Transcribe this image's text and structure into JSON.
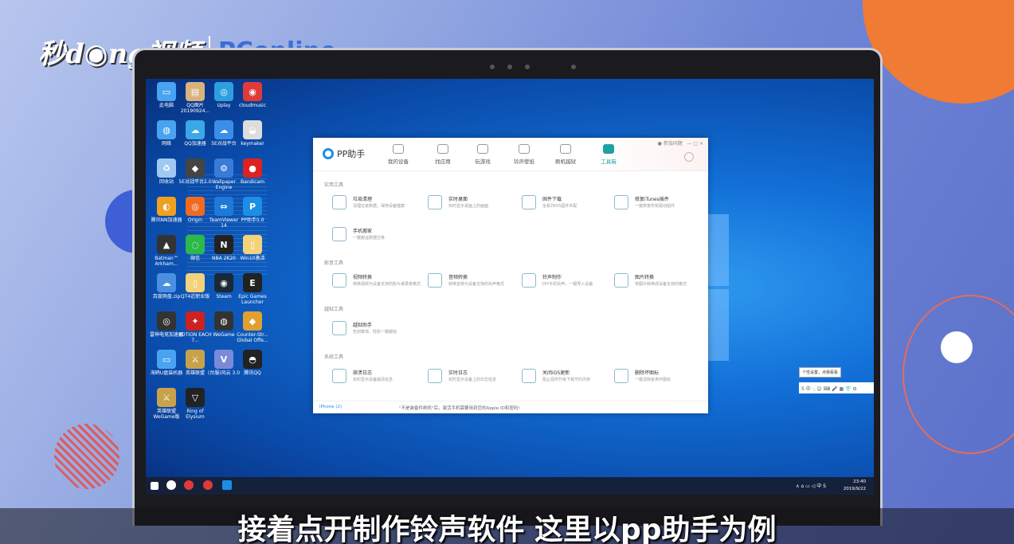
{
  "brand": {
    "left": "秒d◉ng视频",
    "right": "PConline"
  },
  "desktop_icons": [
    {
      "label": "此电脑",
      "color": "#4aa3f0",
      "glyph": "▭"
    },
    {
      "label": "QQ图片20190924...",
      "color": "#d9b27c",
      "glyph": "▤"
    },
    {
      "label": "Uplay",
      "color": "#2b9fe0",
      "glyph": "◎"
    },
    {
      "label": "cloudmusic",
      "color": "#e03a3a",
      "glyph": "◉"
    },
    {
      "label": "网络",
      "color": "#4aa3f0",
      "glyph": "◍"
    },
    {
      "label": "QQ加速器",
      "color": "#3aa7e8",
      "glyph": "☁"
    },
    {
      "label": "5E对战平台",
      "color": "#3a8ee8",
      "glyph": "☁"
    },
    {
      "label": "keymaker",
      "color": "#ddd",
      "glyph": "◒"
    },
    {
      "label": "回收站",
      "color": "#9ec9f0",
      "glyph": "♻"
    },
    {
      "label": "5E对战平台2.0",
      "color": "#444",
      "glyph": "◆"
    },
    {
      "label": "Wallpaper Engine",
      "color": "#3a7ad8",
      "glyph": "⚙"
    },
    {
      "label": "Bandicam",
      "color": "#d22",
      "glyph": "●"
    },
    {
      "label": "腾讯NN加速器",
      "color": "#f0a020",
      "glyph": "◐"
    },
    {
      "label": "Origin",
      "color": "#f06a20",
      "glyph": "◎"
    },
    {
      "label": "TeamViewer 14",
      "color": "#1e7ad8",
      "glyph": "⇔"
    },
    {
      "label": "PP助手5.0",
      "color": "#1d8ee6",
      "glyph": "P"
    },
    {
      "label": "Batman™ Arkham...",
      "color": "#333",
      "glyph": "▲"
    },
    {
      "label": "微信",
      "color": "#2db84a",
      "glyph": "◌"
    },
    {
      "label": "NBA 2K20",
      "color": "#222",
      "glyph": "N"
    },
    {
      "label": "Win10激活",
      "color": "#f2d27a",
      "glyph": "▯"
    },
    {
      "label": "百度网盘.zip",
      "color": "#4a90e2",
      "glyph": "☁"
    },
    {
      "label": "QT4近职业版",
      "color": "#f2d27a",
      "glyph": "▯"
    },
    {
      "label": "Steam",
      "color": "#1b2838",
      "glyph": "◉"
    },
    {
      "label": "Epic Games Launcher",
      "color": "#222",
      "glyph": "E"
    },
    {
      "label": "雷神电竞加速器",
      "color": "#333",
      "glyph": "◎"
    },
    {
      "label": "KOTION EACH 7...",
      "color": "#c22",
      "glyph": "✦"
    },
    {
      "label": "WeGame",
      "color": "#333",
      "glyph": "◍"
    },
    {
      "label": "Counter-Str... Global Offe...",
      "color": "#e0a030",
      "glyph": "◆"
    },
    {
      "label": "海鸥U盘装机器",
      "color": "#4aa3f0",
      "glyph": "▭"
    },
    {
      "label": "英雄联盟",
      "color": "#c8a24a",
      "glyph": "⚔"
    },
    {
      "label": "(台服)风云 3.0",
      "color": "#7a8ad8",
      "glyph": "V"
    },
    {
      "label": "腾讯QQ",
      "color": "#222",
      "glyph": "◓"
    },
    {
      "label": "英雄联盟 WeGame版",
      "color": "#c8a24a",
      "glyph": "⚔"
    },
    {
      "label": "Ring of Elysium",
      "color": "#222",
      "glyph": "▽"
    }
  ],
  "pp": {
    "logo_text": "PP助手",
    "tabs": [
      "我的设备",
      "找应用",
      "玩游戏",
      "铃声壁纸",
      "刷机越狱",
      "工具箱"
    ],
    "active_tab": 5,
    "header_link": "● 参加问题",
    "window_controls": "— □ ×",
    "sections": [
      "实用工具",
      "影音工具",
      "越狱工具",
      "系统工具"
    ],
    "tools": [
      {
        "name": "垃圾清理",
        "desc": "清理垃圾数据，保持设备健康"
      },
      {
        "name": "实时桌面",
        "desc": "实时显示桌面上的画面"
      },
      {
        "name": "固件下载",
        "desc": "全系列iOS固件匹配"
      },
      {
        "name": "修复iTunes插件",
        "desc": "一键修复所有驱动组件"
      },
      {
        "name": "手机搬家",
        "desc": "一键搬运数据迁移"
      },
      {
        "name": "视频转换",
        "desc": "转换视频为设备支持的影片或录像格式"
      },
      {
        "name": "音频转换",
        "desc": "转换音频为设备支持的铃声格式"
      },
      {
        "name": "铃声制作",
        "desc": "DIY手机铃声，一键导入设备"
      },
      {
        "name": "图片转换",
        "desc": "将图片转换成设备支持的格式"
      },
      {
        "name": "越狱助手",
        "desc": "告别繁琐，轻松一键越狱"
      },
      {
        "name": "崩溃日志",
        "desc": "实时显示设备崩溃信息"
      },
      {
        "name": "实时日志",
        "desc": "实时显示设备上的日志信息"
      },
      {
        "name": "关闭iOS更新",
        "desc": "阻止固件升级下载节约内存"
      },
      {
        "name": "删除坏图标",
        "desc": "一键清除各类坏图标"
      }
    ],
    "status_device": "iPhone (2)",
    "status_message": "\"不是装备件刷机\"后，激活手机需要用到您的Apple ID和密码!"
  },
  "ime_tip": "个性设置，点我看看",
  "ime_bar": "S 中 ·, ☺ ⌨ 🎤 ▦ 👕 ⚙",
  "clock": {
    "time": "23:40",
    "date": "2019/9/22"
  },
  "tray": "∧ ⌂ ▭ ◁ 中 S",
  "subtitle": "接着点开制作铃声软件 这里以pp助手为例"
}
